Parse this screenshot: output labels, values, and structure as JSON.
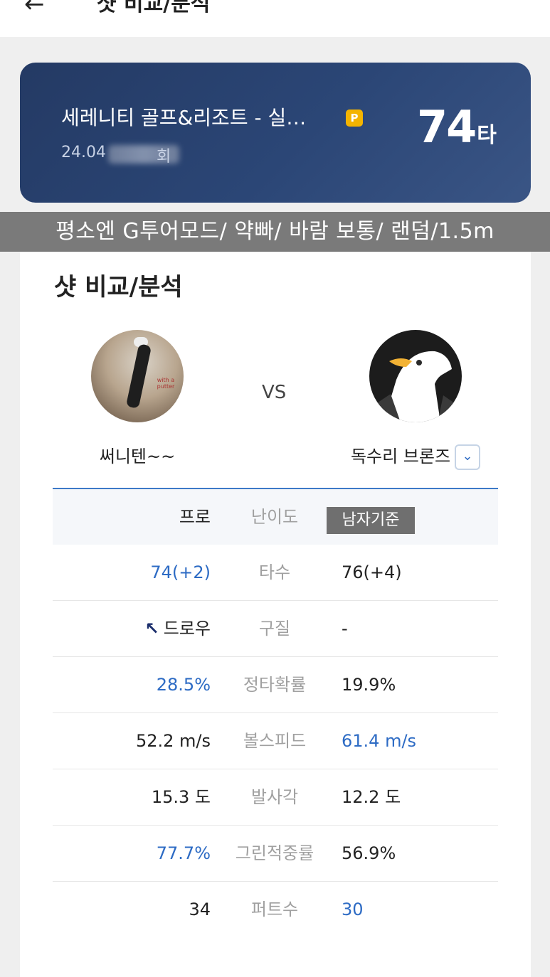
{
  "header": {
    "back_icon": "arrow-left-icon",
    "back_glyph": "←",
    "title": "샷 비교/분석"
  },
  "round_card": {
    "course_name": "세레니티 골프&리조트 - 실…",
    "badge": "P",
    "date": "24.04",
    "date_suffix": "회",
    "score_value": "74",
    "score_unit": "타",
    "colors": {
      "background": "#2b4676",
      "badge": "#f4b400"
    }
  },
  "settings_banner": "평소엔 G투어모드/ 약빠/ 바람 보통/ 랜덤/1.5m",
  "panel": {
    "title": "샷 비교/분석",
    "vs": "VS",
    "me": {
      "nickname": "써니텐~~",
      "avatar_icon": "golfer-photo-avatar"
    },
    "opponent": {
      "nickname": "독수리 브론즈",
      "avatar_icon": "eagle-avatar",
      "dropdown_icon": "chevron-down-icon",
      "dropdown_glyph": "⌄"
    }
  },
  "table": {
    "header": {
      "left": "프로",
      "mid": "난이도",
      "right": "남자기준"
    },
    "rows": [
      {
        "left": "74(+2)",
        "mid": "타수",
        "right": "76(+4)",
        "highlight": "left"
      },
      {
        "left": "드로우",
        "left_icon": "arrow-up-left-icon",
        "left_glyph": "↖",
        "mid": "구질",
        "right": "-",
        "highlight": "none"
      },
      {
        "left": "28.5%",
        "mid": "정타확률",
        "right": "19.9%",
        "highlight": "left"
      },
      {
        "left": "52.2 m/s",
        "mid": "볼스피드",
        "right": "61.4 m/s",
        "highlight": "right"
      },
      {
        "left": "15.3 도",
        "mid": "발사각",
        "right": "12.2 도",
        "highlight": "none"
      },
      {
        "left": "77.7%",
        "mid": "그린적중률",
        "right": "56.9%",
        "highlight": "left"
      },
      {
        "left": "34",
        "mid": "퍼트수",
        "right": "30",
        "highlight": "right"
      }
    ],
    "colors": {
      "highlight": "#2d6bc4",
      "header_rule": "#3d79c8"
    }
  }
}
